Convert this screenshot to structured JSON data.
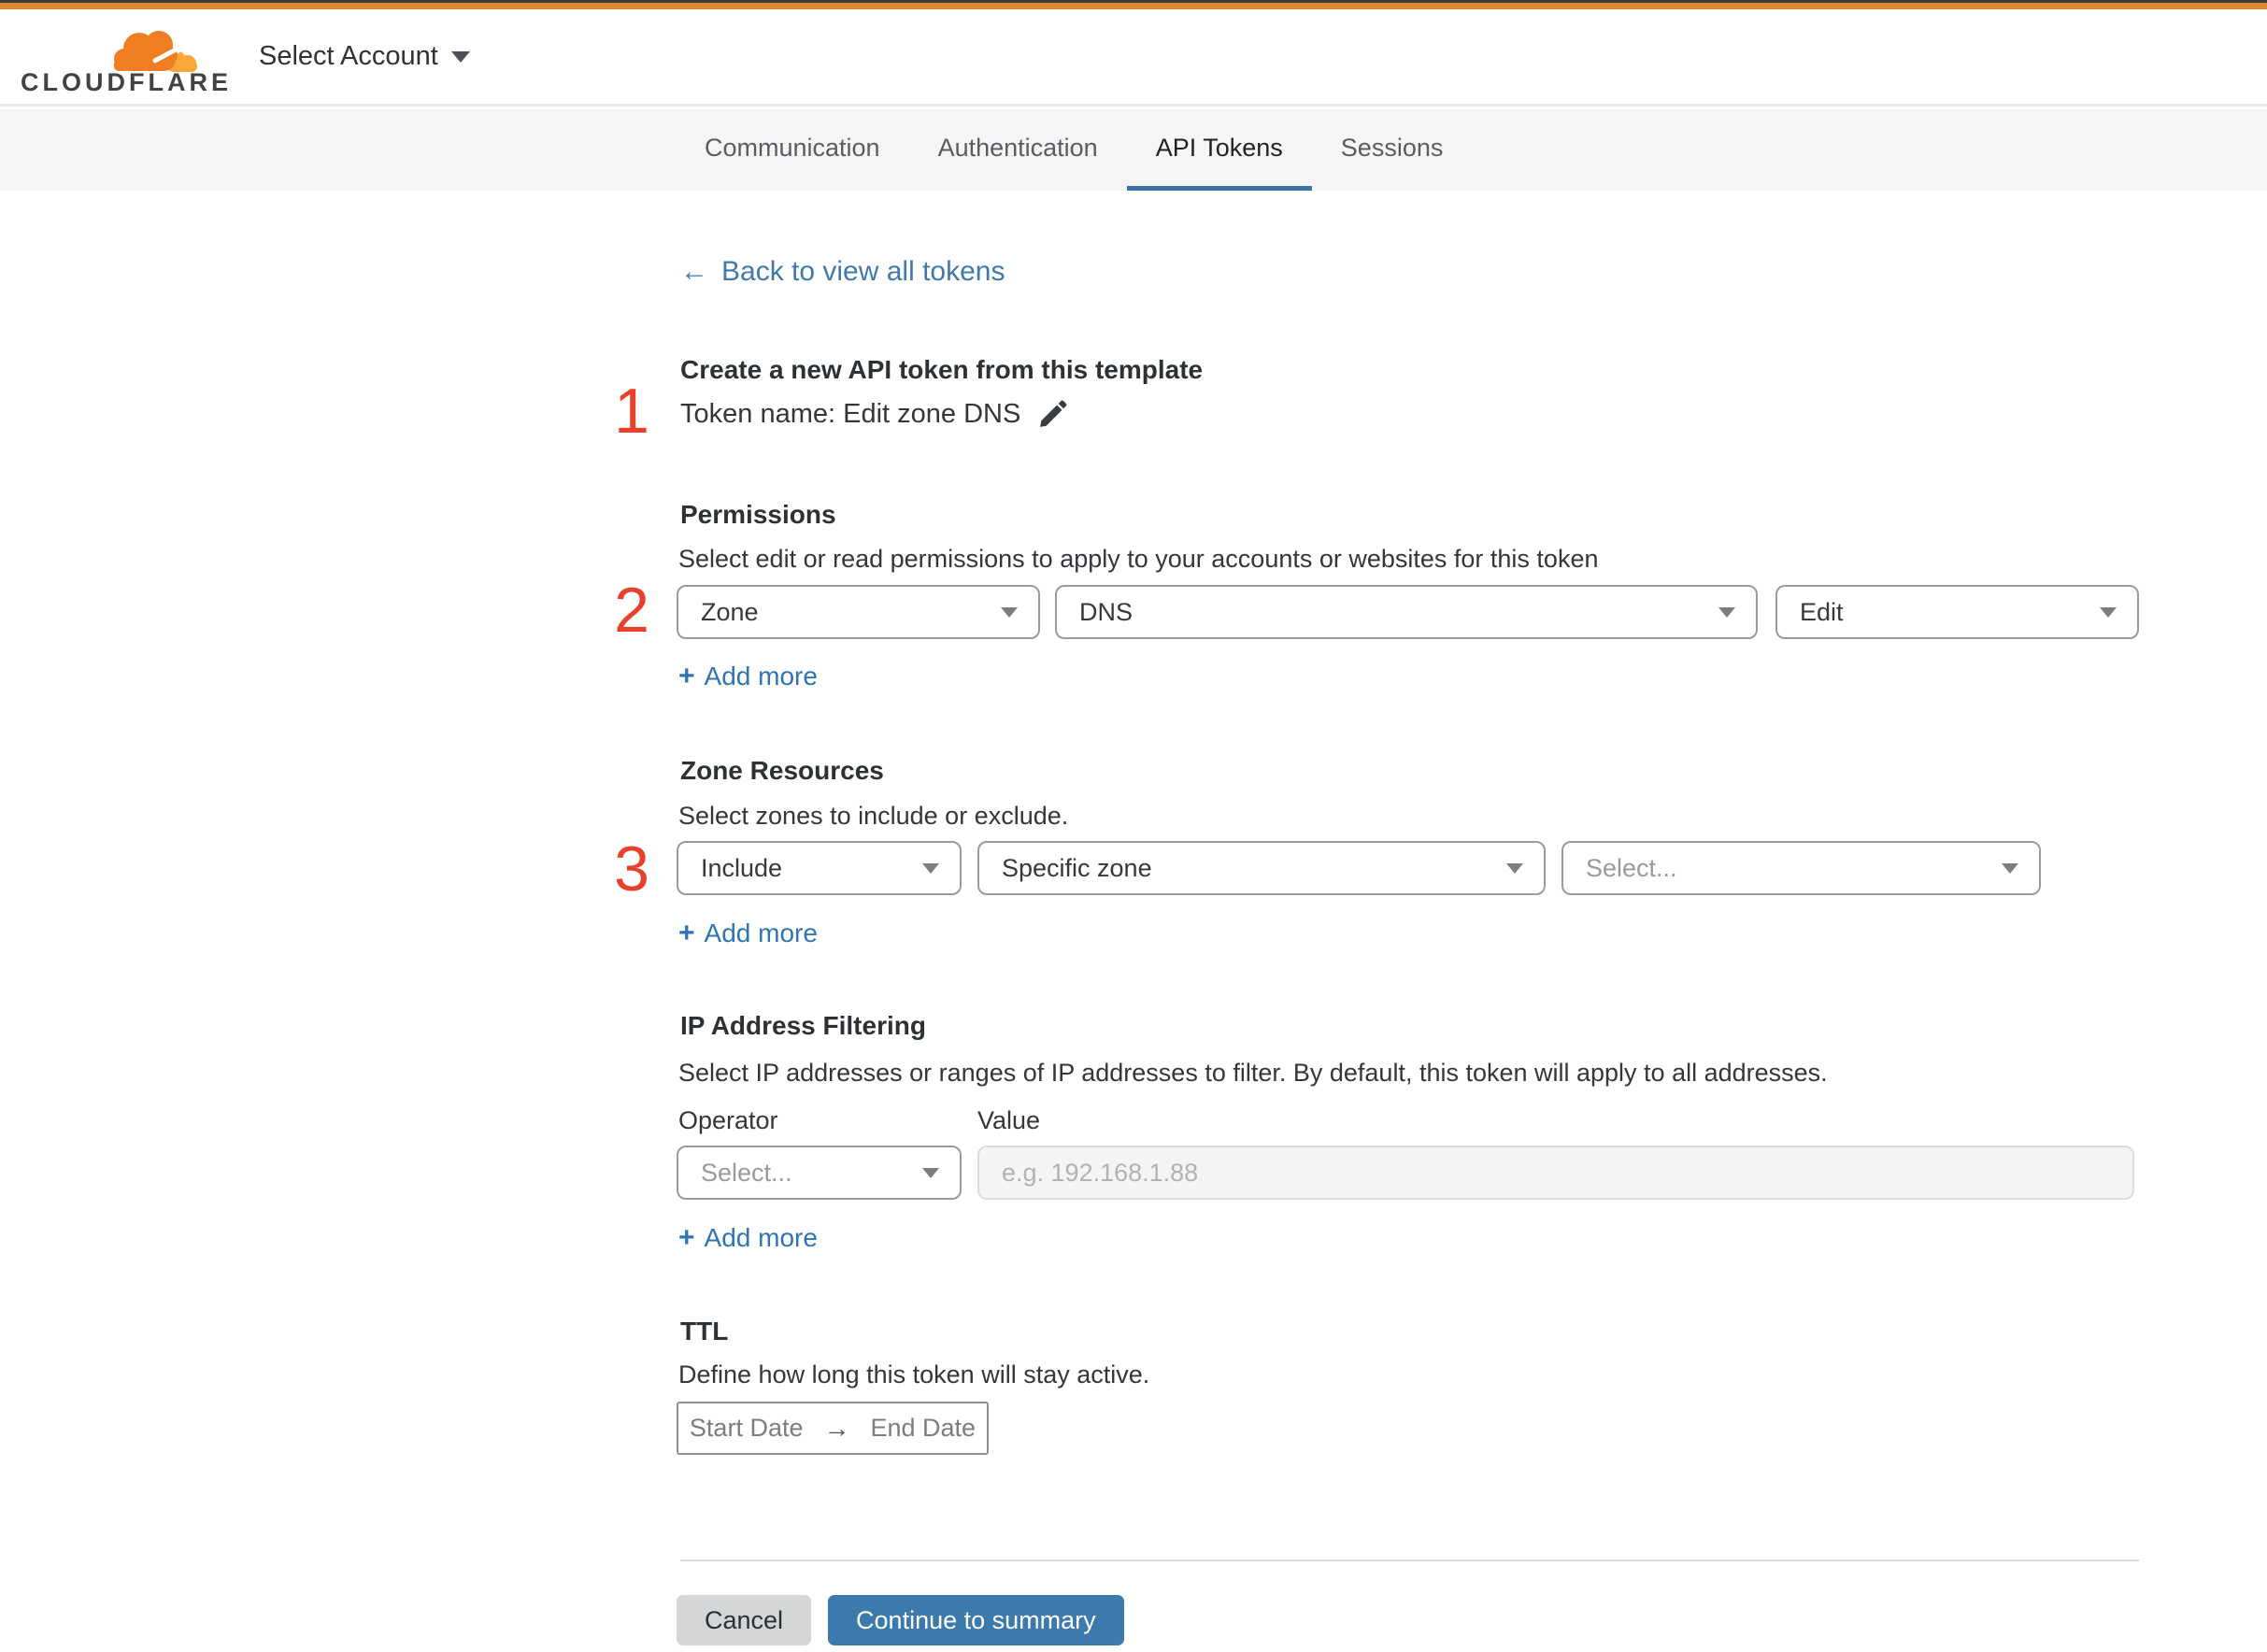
{
  "colors": {
    "accent_orange": "#dd8a35",
    "link_blue": "#3c79ad",
    "marker_red": "#e8402a",
    "tab_active_underline": "#3b73a8"
  },
  "header": {
    "brand": "CLOUDFLARE",
    "account_selector": "Select Account"
  },
  "tabs": {
    "items": [
      {
        "label": "Communication",
        "active": false
      },
      {
        "label": "Authentication",
        "active": false
      },
      {
        "label": "API Tokens",
        "active": true
      },
      {
        "label": "Sessions",
        "active": false
      }
    ]
  },
  "icons": {
    "back_arrow": "←",
    "plus": "+",
    "range_arrow": "→"
  },
  "markers": {
    "step1": "1",
    "step2": "2",
    "step3": "3"
  },
  "page": {
    "back_link": "Back to view all tokens",
    "create": {
      "title": "Create a new API token from this template",
      "token_name": "Token name: Edit zone DNS"
    },
    "permissions": {
      "title": "Permissions",
      "description": "Select edit or read permissions to apply to your accounts or websites for this token",
      "scope_value": "Zone",
      "resource_value": "DNS",
      "access_value": "Edit",
      "add_more": "Add more"
    },
    "zone_resources": {
      "title": "Zone Resources",
      "description": "Select zones to include or exclude.",
      "mode_value": "Include",
      "scope_value": "Specific zone",
      "zone_value": "Select...",
      "add_more": "Add more"
    },
    "ip_filtering": {
      "title": "IP Address Filtering",
      "description": "Select IP addresses or ranges of IP addresses to filter. By default, this token will apply to all addresses.",
      "operator_label": "Operator",
      "value_label": "Value",
      "operator_value": "Select...",
      "value_placeholder": "e.g. 192.168.1.88",
      "add_more": "Add more"
    },
    "ttl": {
      "title": "TTL",
      "description": "Define how long this token will stay active.",
      "start_date": "Start Date",
      "end_date": "End Date"
    },
    "footer": {
      "cancel": "Cancel",
      "continue": "Continue to summary"
    }
  }
}
